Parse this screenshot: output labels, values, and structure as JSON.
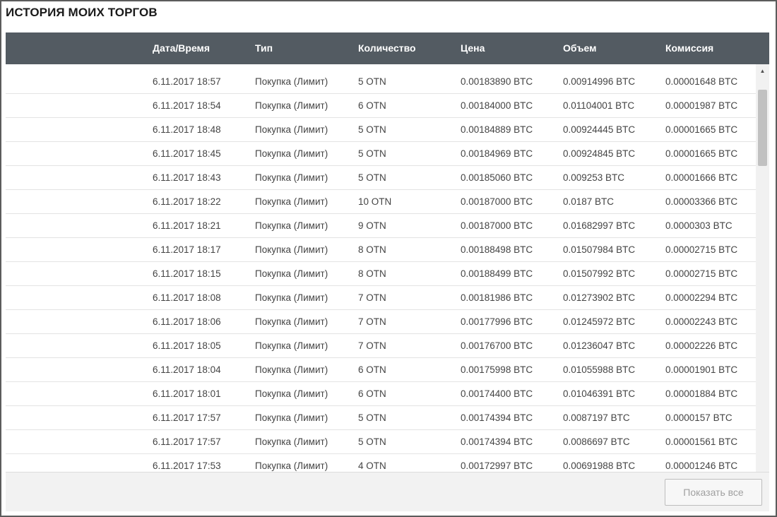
{
  "panel": {
    "title": "ИСТОРИЯ МОИХ ТОРГОВ"
  },
  "table": {
    "columns": [
      "Дата/Время",
      "Тип",
      "Количество",
      "Цена",
      "Объем",
      "Комиссия"
    ],
    "rows": [
      [
        "6.11.2017 18:57",
        "Покупка (Лимит)",
        "5 OTN",
        "0.00183890 BTC",
        "0.00914996 BTC",
        "0.00001648 BTC"
      ],
      [
        "6.11.2017 18:54",
        "Покупка (Лимит)",
        "6 OTN",
        "0.00184000 BTC",
        "0.01104001 BTC",
        "0.00001987 BTC"
      ],
      [
        "6.11.2017 18:48",
        "Покупка (Лимит)",
        "5 OTN",
        "0.00184889 BTC",
        "0.00924445 BTC",
        "0.00001665 BTC"
      ],
      [
        "6.11.2017 18:45",
        "Покупка (Лимит)",
        "5 OTN",
        "0.00184969 BTC",
        "0.00924845 BTC",
        "0.00001665 BTC"
      ],
      [
        "6.11.2017 18:43",
        "Покупка (Лимит)",
        "5 OTN",
        "0.00185060 BTC",
        "0.009253 BTC",
        "0.00001666 BTC"
      ],
      [
        "6.11.2017 18:22",
        "Покупка (Лимит)",
        "10 OTN",
        "0.00187000 BTC",
        "0.0187 BTC",
        "0.00003366 BTC"
      ],
      [
        "6.11.2017 18:21",
        "Покупка (Лимит)",
        "9 OTN",
        "0.00187000 BTC",
        "0.01682997 BTC",
        "0.0000303 BTC"
      ],
      [
        "6.11.2017 18:17",
        "Покупка (Лимит)",
        "8 OTN",
        "0.00188498 BTC",
        "0.01507984 BTC",
        "0.00002715 BTC"
      ],
      [
        "6.11.2017 18:15",
        "Покупка (Лимит)",
        "8 OTN",
        "0.00188499 BTC",
        "0.01507992 BTC",
        "0.00002715 BTC"
      ],
      [
        "6.11.2017 18:08",
        "Покупка (Лимит)",
        "7 OTN",
        "0.00181986 BTC",
        "0.01273902 BTC",
        "0.00002294 BTC"
      ],
      [
        "6.11.2017 18:06",
        "Покупка (Лимит)",
        "7 OTN",
        "0.00177996 BTC",
        "0.01245972 BTC",
        "0.00002243 BTC"
      ],
      [
        "6.11.2017 18:05",
        "Покупка (Лимит)",
        "7 OTN",
        "0.00176700 BTC",
        "0.01236047 BTC",
        "0.00002226 BTC"
      ],
      [
        "6.11.2017 18:04",
        "Покупка (Лимит)",
        "6 OTN",
        "0.00175998 BTC",
        "0.01055988 BTC",
        "0.00001901 BTC"
      ],
      [
        "6.11.2017 18:01",
        "Покупка (Лимит)",
        "6 OTN",
        "0.00174400 BTC",
        "0.01046391 BTC",
        "0.00001884 BTC"
      ],
      [
        "6.11.2017 17:57",
        "Покупка (Лимит)",
        "5 OTN",
        "0.00174394 BTC",
        "0.0087197 BTC",
        "0.0000157 BTC"
      ],
      [
        "6.11.2017 17:57",
        "Покупка (Лимит)",
        "5 OTN",
        "0.00174394 BTC",
        "0.0086697 BTC",
        "0.00001561 BTC"
      ],
      [
        "6.11.2017 17:53",
        "Покупка (Лимит)",
        "4 OTN",
        "0.00172997 BTC",
        "0.00691988 BTC",
        "0.00001246 BTC"
      ]
    ]
  },
  "scrollbar": {
    "up_icon": "▲",
    "down_icon": "▼"
  },
  "footer": {
    "show_all_label": "Показать все"
  }
}
